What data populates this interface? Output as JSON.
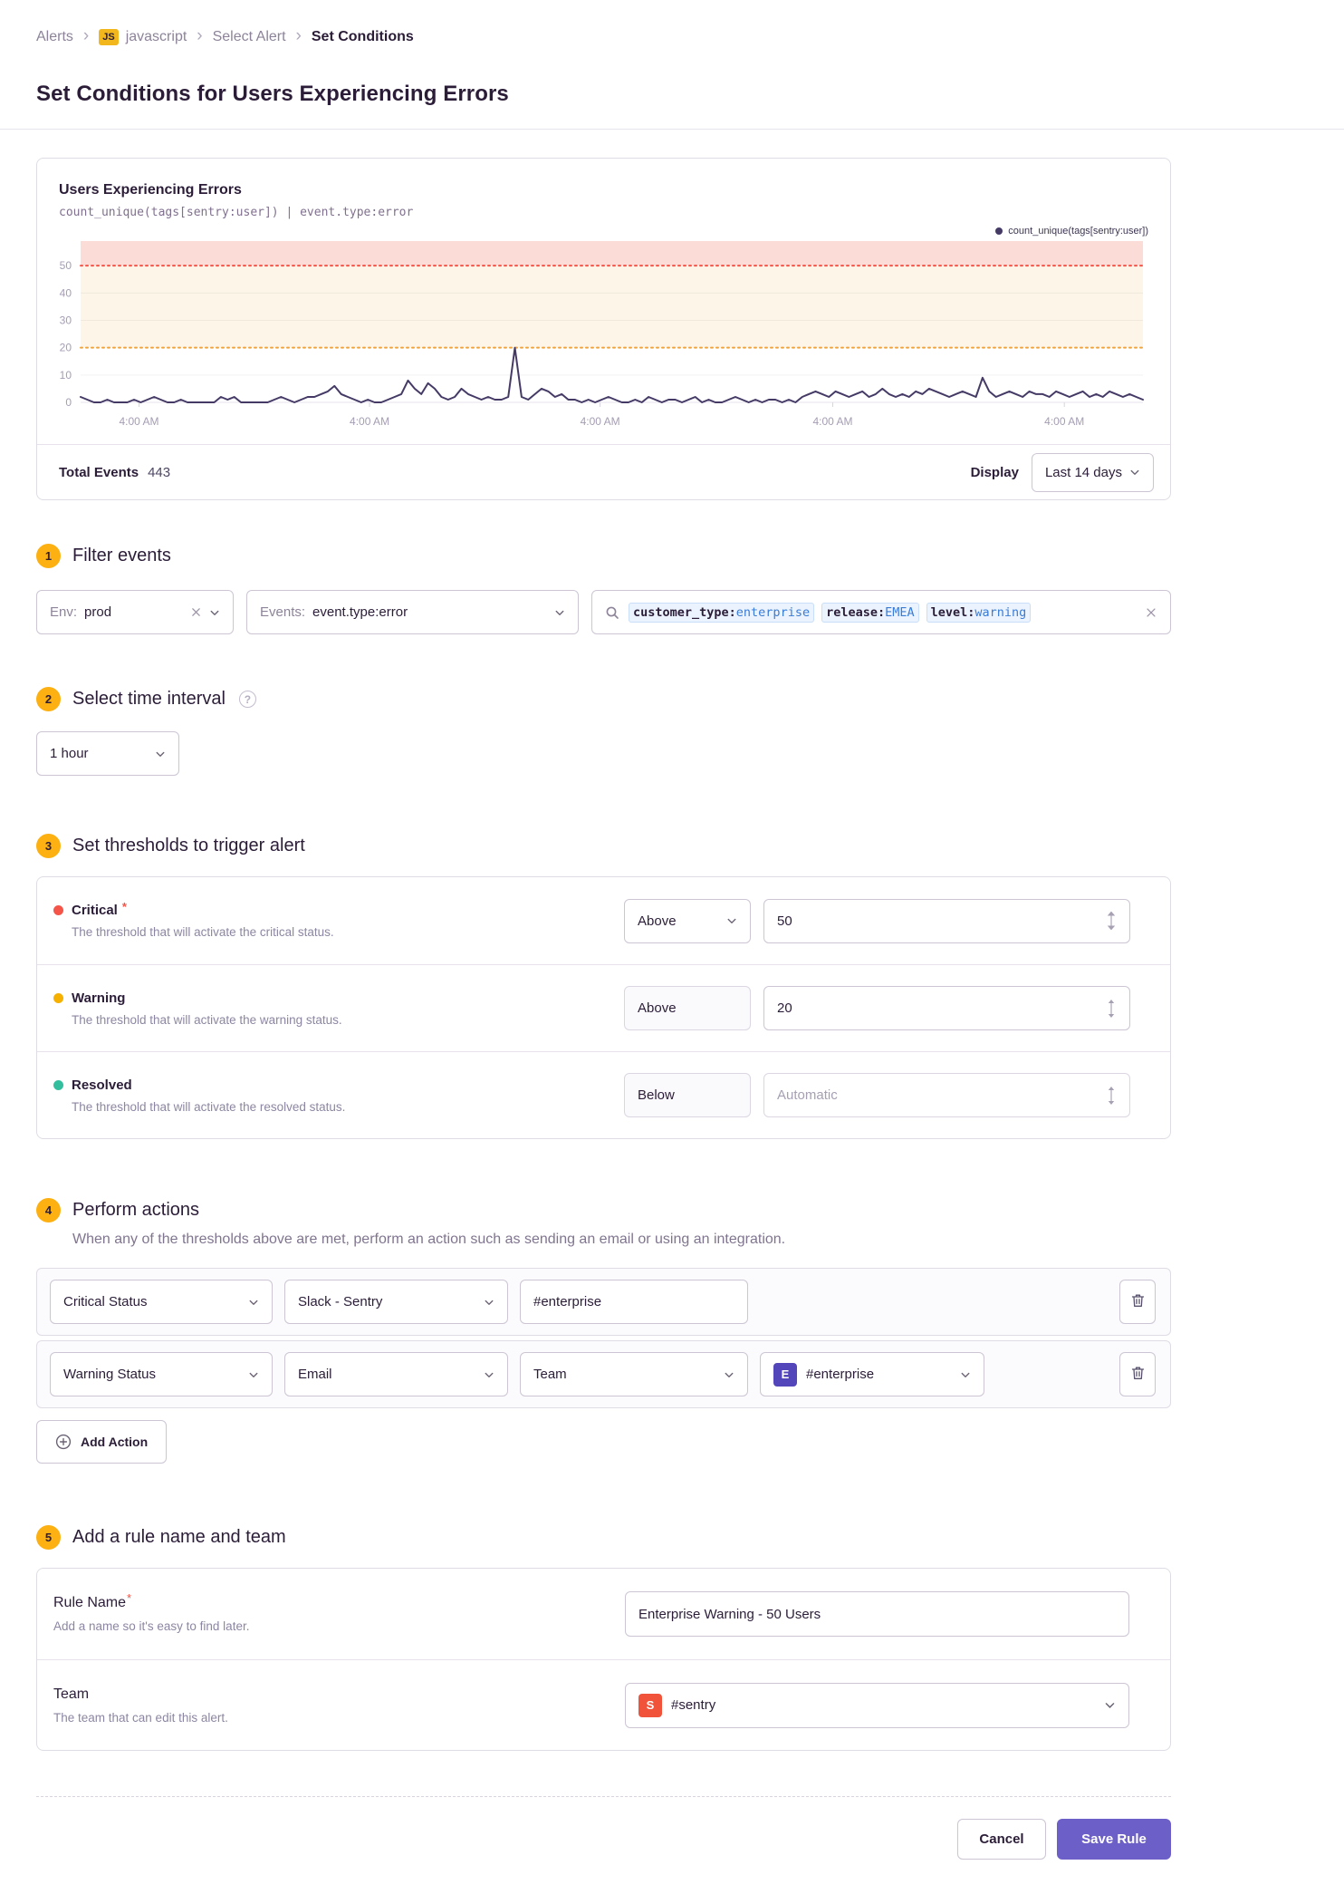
{
  "breadcrumb": {
    "items": [
      "Alerts",
      "javascript",
      "Select Alert",
      "Set Conditions"
    ],
    "platform_badge": "JS"
  },
  "page": {
    "title": "Set Conditions for Users Experiencing Errors"
  },
  "chart_panel": {
    "title": "Users Experiencing Errors",
    "query": "count_unique(tags[sentry:user]) | event.type:error",
    "legend": "count_unique(tags[sentry:user])",
    "total_events_label": "Total Events",
    "total_events_value": "443",
    "display_label": "Display",
    "range_button": "Last 14 days"
  },
  "chart_data": {
    "type": "line",
    "title": "Users Experiencing Errors",
    "query": "count_unique(tags[sentry:user]) | event.type:error",
    "series": [
      {
        "name": "count_unique(tags[sentry:user])",
        "values": [
          2,
          1,
          0,
          0,
          1,
          0,
          0,
          0,
          1,
          0,
          1,
          2,
          1,
          0,
          0,
          1,
          0,
          0,
          0,
          0,
          0,
          2,
          1,
          2,
          0,
          0,
          0,
          0,
          0,
          1,
          2,
          1,
          0,
          1,
          2,
          2,
          3,
          4,
          6,
          3,
          2,
          1,
          0,
          1,
          0,
          0,
          1,
          2,
          3,
          8,
          5,
          3,
          7,
          5,
          2,
          1,
          2,
          5,
          3,
          2,
          1,
          2,
          1,
          1,
          2,
          20,
          2,
          1,
          3,
          5,
          4,
          2,
          3,
          1,
          1,
          0,
          1,
          0,
          1,
          2,
          1,
          0,
          0,
          1,
          0,
          2,
          1,
          0,
          1,
          1,
          0,
          1,
          2,
          0,
          1,
          0,
          0,
          1,
          2,
          1,
          0,
          1,
          0,
          1,
          1,
          0,
          1,
          0,
          2,
          3,
          4,
          3,
          2,
          4,
          3,
          2,
          3,
          4,
          2,
          3,
          5,
          3,
          2,
          3,
          2,
          4,
          3,
          5,
          4,
          3,
          2,
          3,
          4,
          3,
          2,
          9,
          4,
          2,
          3,
          4,
          3,
          2,
          4,
          3,
          3,
          2,
          4,
          3,
          2,
          3,
          4,
          2,
          3,
          2,
          4,
          3,
          2,
          3,
          2,
          1
        ]
      }
    ],
    "ylim": [
      0,
      59
    ],
    "yticks": [
      0,
      10,
      20,
      30,
      40,
      50
    ],
    "grid": [
      10,
      30,
      40
    ],
    "xticks": {
      "labels": [
        "4:00 AM",
        "4:00 AM",
        "4:00 AM",
        "4:00 AM",
        "4:00 AM"
      ],
      "fractions": [
        0.055,
        0.272,
        0.489,
        0.708,
        0.926
      ]
    },
    "thresholds": {
      "critical": 50,
      "warning": 20
    },
    "total_events": 443,
    "time_range": "Last 14 days",
    "legend_position": "top-right"
  },
  "steps": {
    "filter": {
      "number": "1",
      "title": "Filter events",
      "env_label": "Env:",
      "env_value": "prod",
      "events_label": "Events:",
      "events_value": "event.type:error",
      "tokens": [
        {
          "key": "customer_type:",
          "value": "enterprise"
        },
        {
          "key": "release:",
          "value": "EMEA"
        },
        {
          "key": "level:",
          "value": "warning"
        }
      ]
    },
    "interval": {
      "number": "2",
      "title": "Select time interval",
      "help_icon": "?",
      "value": "1 hour"
    },
    "thresholds": {
      "number": "3",
      "title": "Set thresholds to trigger alert",
      "rows": [
        {
          "label": "Critical",
          "required": "*",
          "description": "The threshold that will activate the critical status.",
          "condition": "Above",
          "value": "50"
        },
        {
          "label": "Warning",
          "description": "The threshold that will activate the warning status.",
          "condition": "Above",
          "value": "20"
        },
        {
          "label": "Resolved",
          "description": "The threshold that will activate the resolved status.",
          "condition": "Below",
          "value": "",
          "value_placeholder": "Automatic"
        }
      ]
    },
    "actions": {
      "number": "4",
      "title": "Perform actions",
      "description": "When any of the thresholds above are met, perform an action such as sending an email or using an integration.",
      "rows": [
        {
          "trigger": "Critical Status",
          "service": "Slack - Sentry",
          "target": "#enterprise"
        },
        {
          "trigger": "Warning Status",
          "service": "Email",
          "target_type": "Team",
          "target": "#enterprise",
          "target_avatar": "E"
        }
      ],
      "add_button": "Add Action"
    },
    "rule": {
      "number": "5",
      "title": "Add a rule name and team",
      "name_label": "Rule Name",
      "name_required": "*",
      "name_help": "Add a name so it's easy to find later.",
      "name_value": "Enterprise Warning - 50 Users",
      "team_label": "Team",
      "team_help": "The team that can edit this alert.",
      "team_value": "#sentry",
      "team_avatar": "S"
    }
  },
  "footer": {
    "cancel": "Cancel",
    "save": "Save Rule"
  },
  "colors": {
    "accent_purple": "#6C5FC7",
    "critical_red": "#F55549",
    "warning_line": "#F1A43B",
    "warning_yellow": "#F5B000",
    "resolved_teal": "#33BF9E",
    "series_line": "#453A66",
    "critical_band": "#FBDCD7",
    "warning_band": "#FCF5E8",
    "step_badge": "#FCB012",
    "token_blue": "#3A7BD5",
    "platform_badge_yellow": "#F1B71C"
  }
}
